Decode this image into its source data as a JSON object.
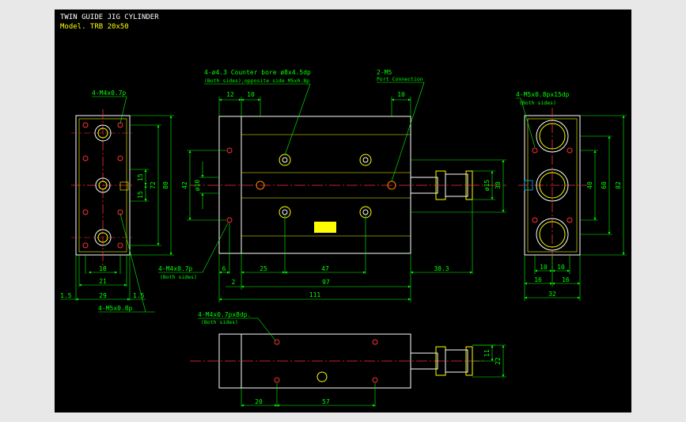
{
  "title": {
    "line1": "TWIN GUIDE JIG CYLINDER",
    "line2": "Model. TRB 20x50"
  },
  "colors": {
    "background": "#000000",
    "outline": "#ffffff",
    "dimension": "#00ff00",
    "centerline": "#ff3030",
    "hidden": "#ffff00",
    "feature": "#ffff00",
    "leader": "#00ff00",
    "text_title": "#ffffff",
    "text_model": "#ffff00"
  },
  "left_view": {
    "callout_top": "4-M4x0.7p",
    "callout_bottom": "4-M5x0.8p",
    "dims": {
      "d15a": "15",
      "d15b": "15",
      "d72": "72",
      "d80": "80",
      "d18": "18",
      "d21": "21",
      "d29": "29",
      "d15_left": "1.5",
      "d15_right": "1.5"
    }
  },
  "front_view": {
    "callout_counterbore_1": "4-ø4.3 Counter bore ø8x4.5dp",
    "callout_counterbore_2": "(Both sides),opposite side M5x0.8p",
    "callout_port_1": "2-M5",
    "callout_port_2": "Port Connection",
    "callout_bottom_1": "4-M4x0.7p",
    "callout_bottom_2": "(Both sides)",
    "dims": {
      "d12": "12",
      "d10": "10",
      "d10b": "10",
      "d42": "42",
      "dphi10": "ø10",
      "dphi15": "ø15",
      "d30": "30",
      "d6": "6",
      "d25": "25",
      "d47": "47",
      "d383": "38.3",
      "d2": "2",
      "d97": "97",
      "d111": "111"
    }
  },
  "right_view": {
    "callout_1": "4-M5x0.8px15dp",
    "callout_2": "(Both sides)",
    "dims": {
      "d40": "40",
      "d60": "60",
      "d82": "82",
      "d10a": "10",
      "d10b": "10",
      "d16a": "16",
      "d16b": "16",
      "d32": "32"
    }
  },
  "bottom_view": {
    "callout_1": "4-M4x0.7px8dp.",
    "callout_2": "(Both sides)",
    "dims": {
      "d11": "11",
      "d22": "22",
      "d20": "20",
      "d57": "57"
    }
  }
}
